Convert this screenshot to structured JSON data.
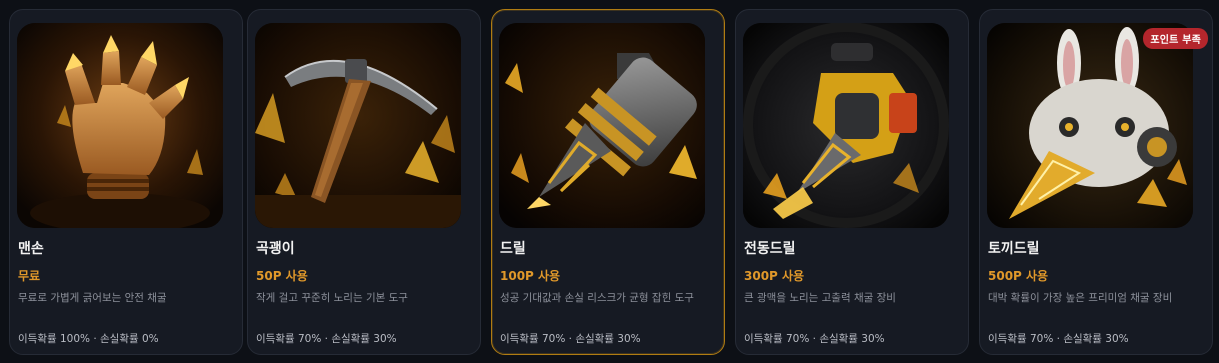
{
  "cards": [
    {
      "name": "맨손",
      "price": "무료",
      "desc": "무료로 가볍게 긁어보는 안전 채굴",
      "stats": "이득확률 100% · 손실확률 0%",
      "icon": "bare-hand"
    },
    {
      "name": "곡괭이",
      "price": "50P 사용",
      "desc": "작게 걸고 꾸준히 노리는 기본 도구",
      "stats": "이득확률 70% · 손실확률 30%",
      "icon": "pickaxe"
    },
    {
      "name": "드릴",
      "price": "100P 사용",
      "desc": "성공 기대값과 손실 리스크가 균형 잡힌 도구",
      "stats": "이득확률 70% · 손실확률 30%",
      "icon": "drill"
    },
    {
      "name": "전동드릴",
      "price": "300P 사용",
      "desc": "큰 광맥을 노리는 고출력 채굴 장비",
      "stats": "이득확률 70% · 손실확률 30%",
      "icon": "power-drill"
    },
    {
      "name": "토끼드릴",
      "price": "500P 사용",
      "desc": "대박 확률이 가장 높은 프리미엄 채굴 장비",
      "stats": "이득확률 70% · 손실확률 30%",
      "icon": "rabbit-drill",
      "badge": "포인트 부족"
    }
  ],
  "colors": {
    "accent": "#e0982a",
    "badge": "#b4262c",
    "selected_border": "#b07c12"
  }
}
